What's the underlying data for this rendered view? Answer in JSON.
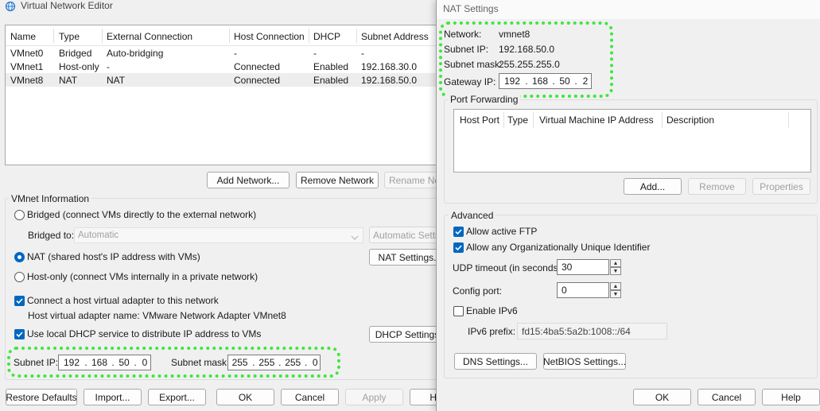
{
  "vne": {
    "title": "Virtual Network Editor",
    "columns": [
      "Name",
      "Type",
      "External Connection",
      "Host Connection",
      "DHCP",
      "Subnet Address"
    ],
    "rows": [
      {
        "name": "VMnet0",
        "type": "Bridged",
        "ext": "Auto-bridging",
        "host": "-",
        "dhcp": "-",
        "subnet": "-"
      },
      {
        "name": "VMnet1",
        "type": "Host-only",
        "ext": "-",
        "host": "Connected",
        "dhcp": "Enabled",
        "subnet": "192.168.30.0"
      },
      {
        "name": "VMnet8",
        "type": "NAT",
        "ext": "NAT",
        "host": "Connected",
        "dhcp": "Enabled",
        "subnet": "192.168.50.0"
      }
    ],
    "add_network": "Add Network...",
    "remove_network": "Remove Network",
    "rename_network": "Rename Net",
    "vmnet_info": "VMnet Information",
    "bridged_label": "Bridged (connect VMs directly to the external network)",
    "bridged_to_label": "Bridged to:",
    "bridged_to_value": "Automatic",
    "auto_settings": "Automatic Settin",
    "nat_label": "NAT (shared host's IP address with VMs)",
    "nat_settings": "NAT Settings.",
    "hostonly_label": "Host-only (connect VMs internally in a private network)",
    "connect_adapter_label": "Connect a host virtual adapter to this network",
    "adapter_name": "Host virtual adapter name: VMware Network Adapter VMnet8",
    "dhcp_label": "Use local DHCP service to distribute IP address to VMs",
    "dhcp_settings": "DHCP Settings",
    "subnet_ip_label": "Subnet IP:",
    "subnet_ip": [
      "192",
      "168",
      "50",
      "0"
    ],
    "subnet_mask_label": "Subnet mask:",
    "subnet_mask": [
      "255",
      "255",
      "255",
      "0"
    ],
    "restore_defaults": "Restore Defaults",
    "import": "Import...",
    "export": "Export...",
    "ok": "OK",
    "cancel": "Cancel",
    "apply": "Apply",
    "help": "H"
  },
  "nat": {
    "title": "NAT Settings",
    "network_label": "Network:",
    "network_value": "vmnet8",
    "subnet_ip_label": "Subnet IP:",
    "subnet_ip_value": "192.168.50.0",
    "subnet_mask_label": "Subnet mask:",
    "subnet_mask_value": "255.255.255.0",
    "gateway_label": "Gateway IP:",
    "gateway_ip": [
      "192",
      "168",
      "50",
      "2"
    ],
    "port_forwarding": "Port Forwarding",
    "pf_columns": [
      "Host Port",
      "Type",
      "Virtual Machine IP Address",
      "Description"
    ],
    "add": "Add...",
    "remove": "Remove",
    "properties": "Properties",
    "advanced": "Advanced",
    "allow_ftp": "Allow active FTP",
    "allow_oui": "Allow any Organizationally Unique Identifier",
    "udp_label": "UDP timeout (in seconds):",
    "udp_value": "30",
    "config_port_label": "Config port:",
    "config_port_value": "0",
    "enable_ipv6": "Enable IPv6",
    "ipv6_prefix_label": "IPv6 prefix:",
    "ipv6_prefix_value": "fd15:4ba5:5a2b:1008::/64",
    "dns_settings": "DNS Settings...",
    "netbios_settings": "NetBIOS Settings...",
    "ok": "OK",
    "cancel": "Cancel",
    "help": "Help"
  },
  "colors": {
    "highlight": "#3ee63e",
    "accent": "#0067c0",
    "dialog_bg": "#f0f0f0"
  }
}
